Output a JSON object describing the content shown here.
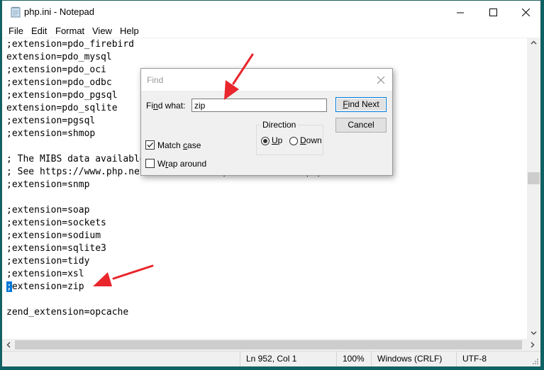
{
  "window": {
    "title": "php.ini - Notepad",
    "controls": {
      "minimize": "minimize-icon",
      "maximize": "maximize-icon",
      "close": "close-icon"
    }
  },
  "menu": [
    "File",
    "Edit",
    "Format",
    "View",
    "Help"
  ],
  "editor": {
    "lines": [
      ";extension=pdo_firebird",
      "extension=pdo_mysql",
      ";extension=pdo_oci",
      ";extension=pdo_odbc",
      ";extension=pdo_pgsql",
      "extension=pdo_sqlite",
      ";extension=pgsql",
      ";extension=shmop",
      "",
      "; The MIBS data available in the PHP distribution must be installed.",
      "; See https://www.php.net/manual/en/snmp.installation.php",
      ";extension=snmp",
      "",
      ";extension=soap",
      ";extension=sockets",
      ";extension=sodium",
      ";extension=sqlite3",
      ";extension=tidy",
      ";extension=xsl",
      ";extension=zip",
      "",
      "zend_extension=opcache",
      "",
      ".................."
    ],
    "selected_line_index": 19,
    "selected_text": ";",
    "selected_rest": "extension=zip"
  },
  "status": {
    "position": "Ln 952, Col 1",
    "zoom": "100%",
    "line_ending": "Windows (CRLF)",
    "encoding": "UTF-8"
  },
  "find_dialog": {
    "title": "Find",
    "find_what_label_pre": "Fi",
    "find_what_label_u": "n",
    "find_what_label_post": "d what:",
    "find_what_value": "zip",
    "find_next_u": "F",
    "find_next_rest": "ind Next",
    "cancel_label": "Cancel",
    "direction_label": "Direction",
    "up_u": "U",
    "up_rest": "p",
    "down_u": "D",
    "down_rest": "own",
    "direction_selected": "Up",
    "match_case_pre": "Match ",
    "match_case_u": "c",
    "match_case_post": "ase",
    "match_case_checked": true,
    "wrap_pre": "W",
    "wrap_u": "r",
    "wrap_post": "ap around",
    "wrap_checked": false
  },
  "annotations": {
    "arrow_color": "#e8262b",
    "arrows": [
      "pointing to find-what input",
      "pointing to ;extension=zip line"
    ]
  }
}
